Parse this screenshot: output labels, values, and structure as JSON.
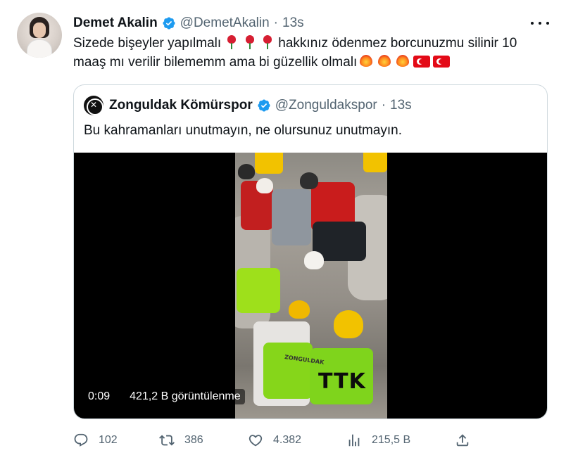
{
  "tweet": {
    "author_name": "Demet Akalin",
    "author_handle": "@DemetAkalin",
    "separator": "·",
    "time": "13s",
    "text_line1_a": "Sizede bişeyler yapılmalı",
    "text_line1_b": "hakkınız ödenmez borcunuzmu  silinir 10",
    "text_line2": "maaş mı verilir bilememm ama bi güzellik olmalı",
    "emoji_line1": [
      "rose",
      "rose",
      "rose"
    ],
    "emoji_line2": [
      "heart-on-fire",
      "heart-on-fire",
      "heart-on-fire",
      "turkey-flag",
      "turkey-flag"
    ]
  },
  "quote": {
    "author_name": "Zonguldak Kömürspor",
    "author_handle": "@Zonguldakspor",
    "separator": "·",
    "time": "13s",
    "text": "Bu kahramanları unutmayın, ne olursunuz unutmayın.",
    "video": {
      "duration": "0:09",
      "views": "421,2 B görüntülenme",
      "overlay_text": "TTK",
      "vest_text": "ZONGULDAK"
    }
  },
  "actions": {
    "replies": "102",
    "retweets": "386",
    "likes": "4.382",
    "views": "215,5 B"
  },
  "colors": {
    "text_primary": "#0f1419",
    "text_secondary": "#536471",
    "verified_blue": "#1d9bf0",
    "border": "#cfd9de"
  }
}
